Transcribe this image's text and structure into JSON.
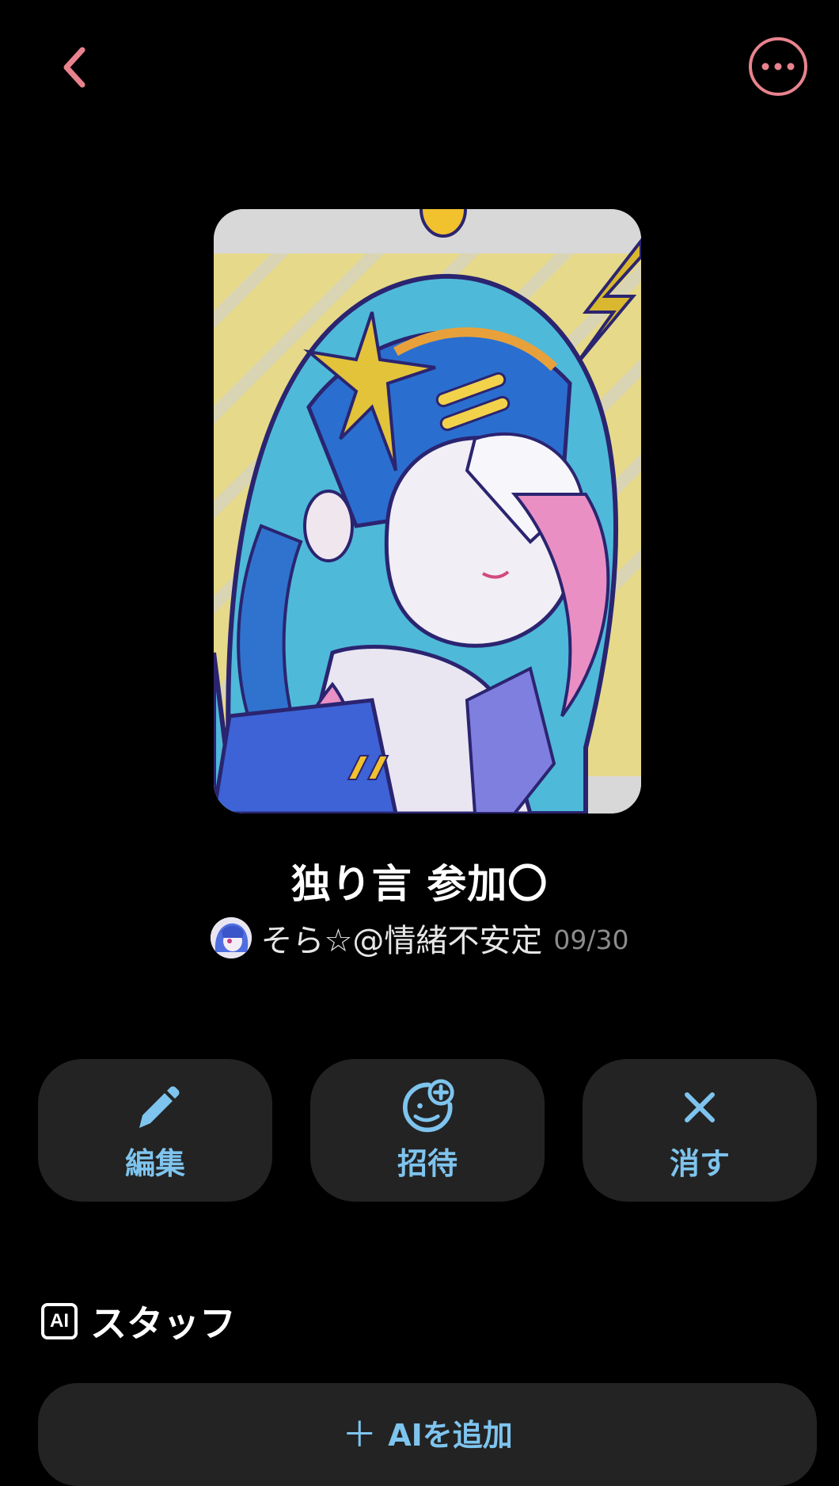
{
  "header": {
    "back_icon": "chevron-left-icon",
    "more_icon": "more-horizontal-icon",
    "accent_color": "#e8838e"
  },
  "room": {
    "title": "独り言 参加〇",
    "owner_name": "そら☆@情緒不安定",
    "member_count": "09/30"
  },
  "actions": {
    "edit_label": "編集",
    "edit_icon": "pencil-icon",
    "invite_label": "招待",
    "invite_icon": "add-user-icon",
    "delete_label": "消す",
    "delete_icon": "close-icon",
    "accent_color": "#7ec4ee"
  },
  "staff": {
    "badge": "AI",
    "title": "スタッフ",
    "add_ai_label": "AIを追加"
  }
}
